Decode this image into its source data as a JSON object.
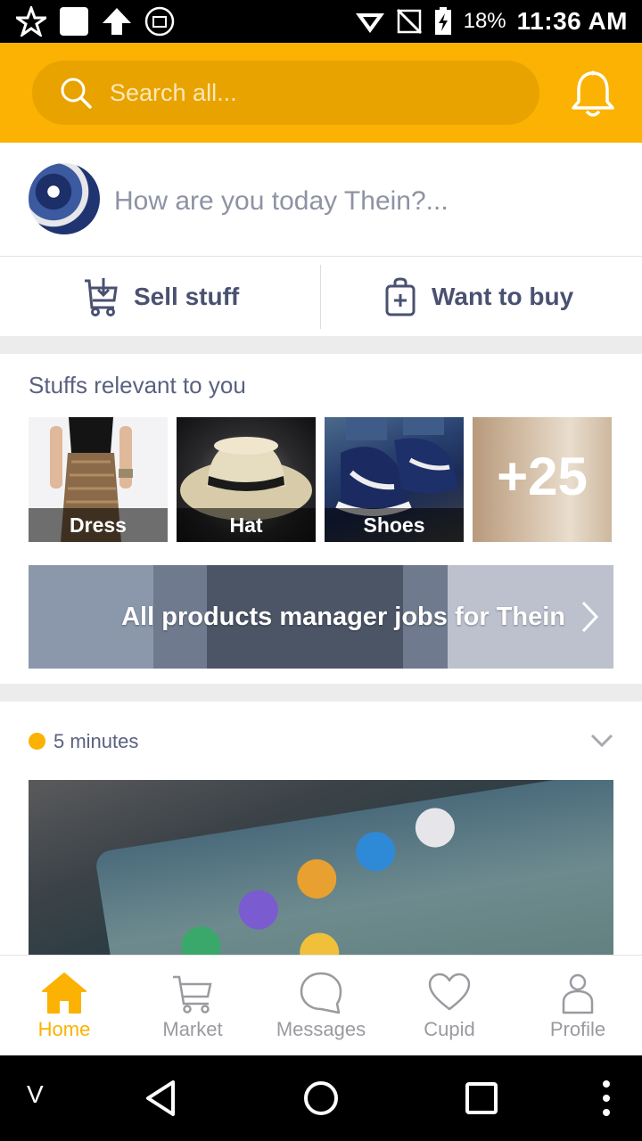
{
  "status_bar": {
    "battery_percent": "18%",
    "time": "11:36 AM",
    "icons": [
      "star-notification-icon",
      "white-square-icon",
      "upload-arrow-icon",
      "photo-notification-icon",
      "wifi-icon",
      "no-signal-icon",
      "battery-charging-icon"
    ]
  },
  "header": {
    "search_placeholder": "Search all...",
    "search_icon": "search-icon",
    "bell_icon": "bell-icon",
    "accent_color": "#fbb202"
  },
  "composer": {
    "prompt": "How are you today Thein?..."
  },
  "actions": {
    "sell_label": "Sell stuff",
    "sell_icon": "cart-download-icon",
    "buy_label": "Want to buy",
    "buy_icon": "shopping-bag-plus-icon"
  },
  "relevant": {
    "title": "Stuffs relevant to you",
    "tiles": [
      {
        "label": "Dress"
      },
      {
        "label": "Hat"
      },
      {
        "label": "Shoes"
      }
    ],
    "more_count": "+25",
    "banner_text": "All products manager jobs for Thein"
  },
  "post": {
    "time": "5 minutes"
  },
  "bottom_nav": {
    "items": [
      {
        "label": "Home",
        "icon": "home-icon",
        "active": true
      },
      {
        "label": "Market",
        "icon": "cart-icon",
        "active": false
      },
      {
        "label": "Messages",
        "icon": "chat-bubble-icon",
        "active": false
      },
      {
        "label": "Cupid",
        "icon": "heart-icon",
        "active": false
      },
      {
        "label": "Profile",
        "icon": "person-icon",
        "active": false
      }
    ]
  },
  "system_nav": {
    "left_label": "V"
  }
}
